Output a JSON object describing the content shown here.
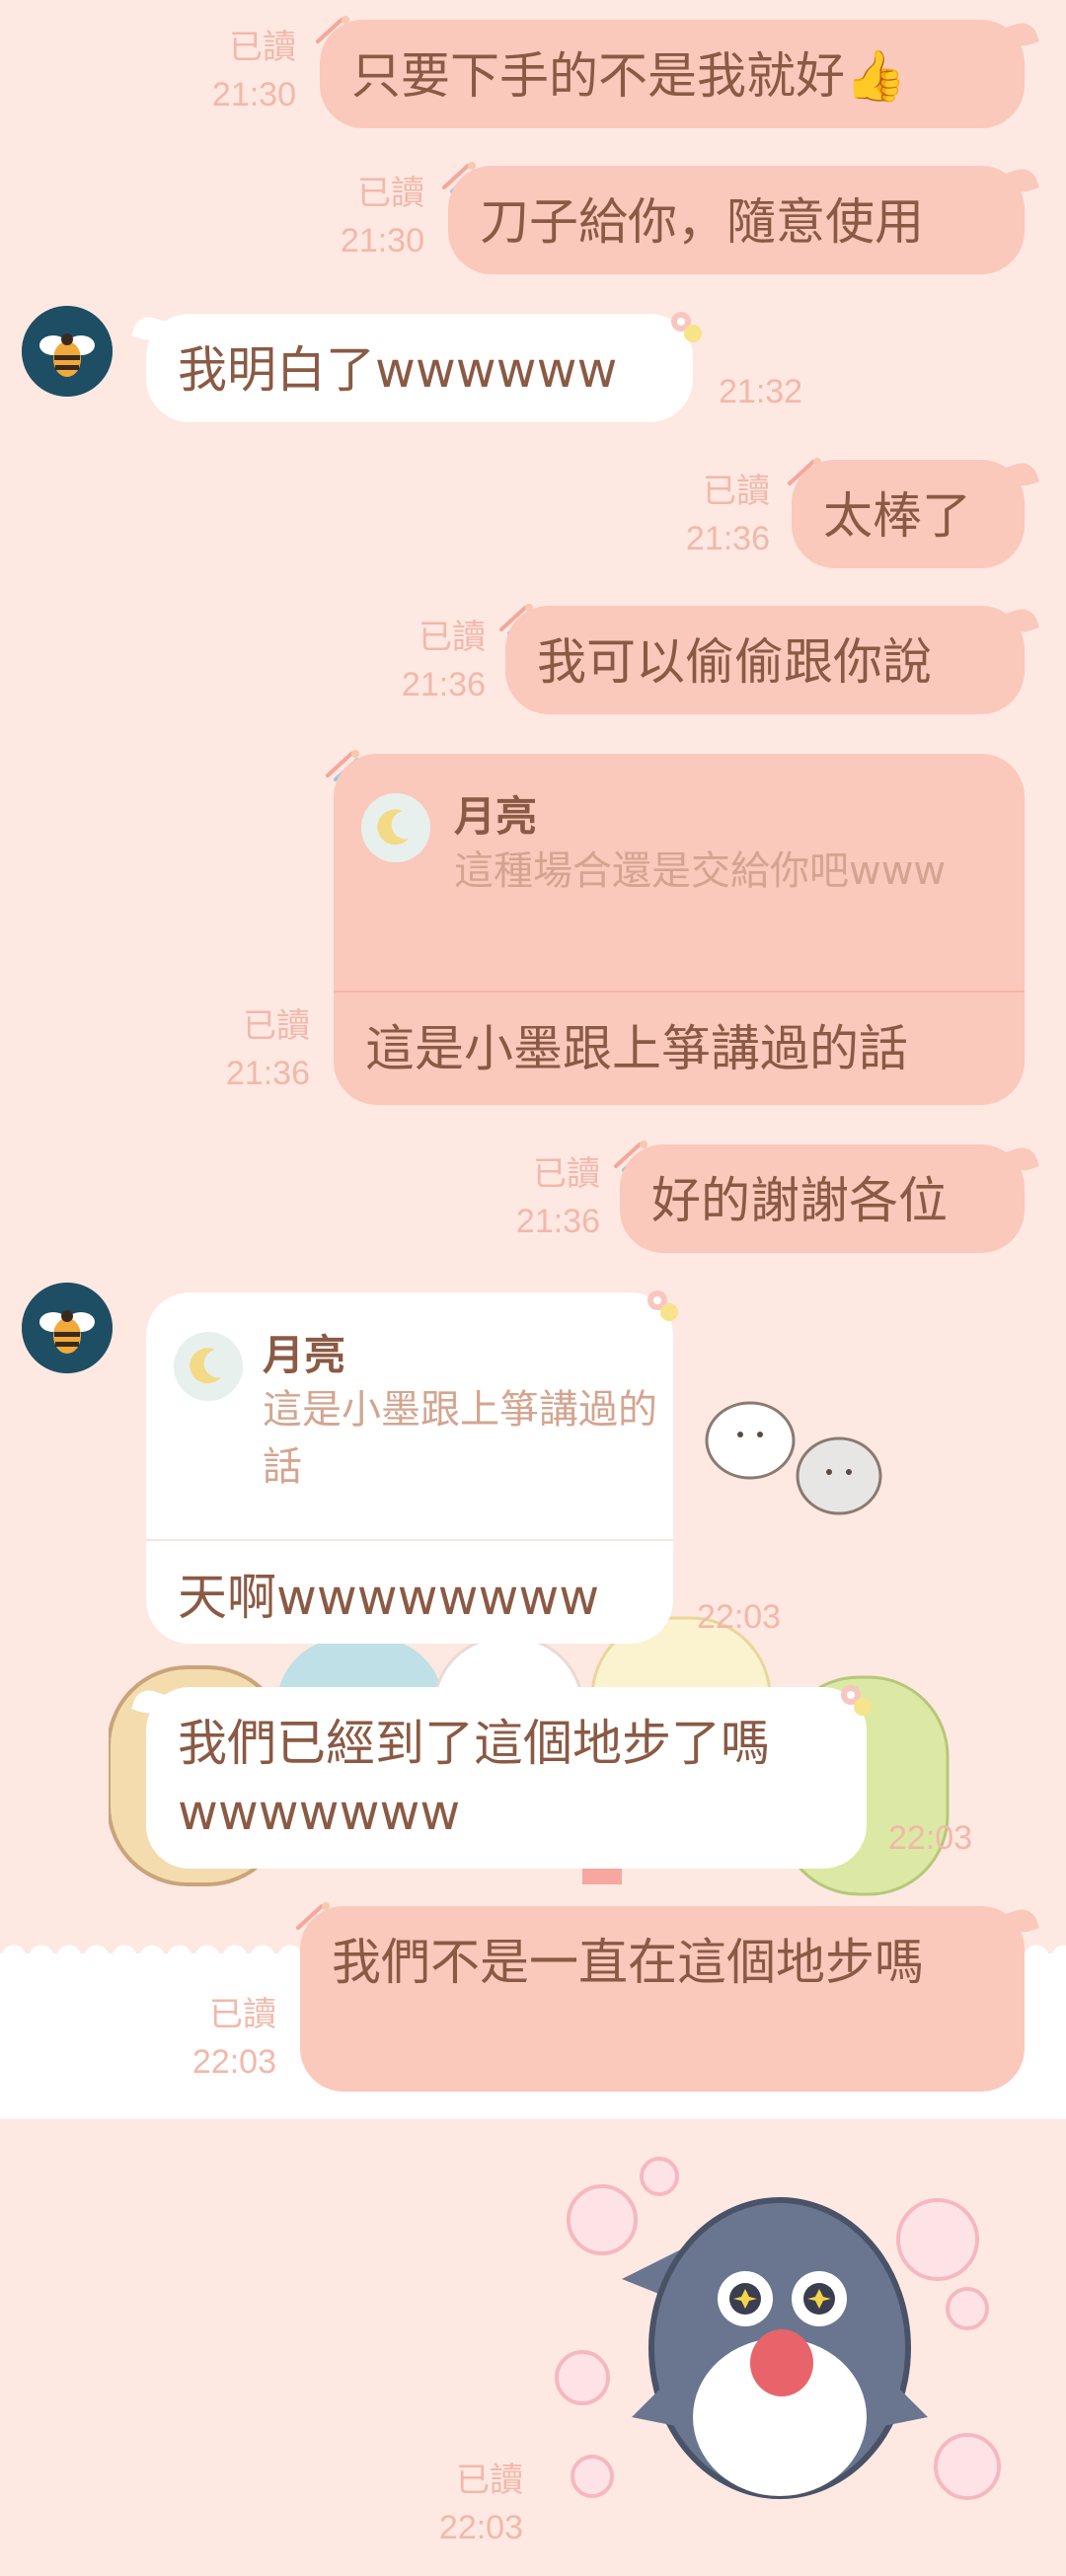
{
  "messages": [
    {
      "type": "out",
      "text": "只要下手的不是我就好👍",
      "read": "已讀",
      "time": "21:30"
    },
    {
      "type": "out",
      "text": "刀子給你，隨意使用",
      "read": "已讀",
      "time": "21:30"
    },
    {
      "type": "in",
      "text": "我明白了wwwwww",
      "time": "21:32"
    },
    {
      "type": "out",
      "text": "太棒了",
      "read": "已讀",
      "time": "21:36"
    },
    {
      "type": "out",
      "text": "我可以偷偷跟你說",
      "read": "已讀",
      "time": "21:36"
    },
    {
      "type": "out-reply",
      "quote_name": "月亮",
      "quote_text": "這種場合還是交給你吧www",
      "text": "這是小墨跟上箏講過的話",
      "read": "已讀",
      "time": "21:36"
    },
    {
      "type": "out",
      "text": "好的謝謝各位",
      "read": "已讀",
      "time": "21:36"
    },
    {
      "type": "in-reply",
      "quote_name": "月亮",
      "quote_text": "這是小墨跟上箏講過的話",
      "text": "天啊wwwwwwww",
      "time": "22:03"
    },
    {
      "type": "in",
      "text": "我們已經到了這個地步了嗎wwwwwww",
      "time": "22:03"
    },
    {
      "type": "out",
      "text": "我們不是一直在這個地步嗎",
      "read": "已讀",
      "time": "22:03"
    },
    {
      "type": "sticker",
      "sticker": "shark-sticker",
      "read": "已讀",
      "time": "22:03"
    }
  ],
  "colors": {
    "background": "#fde8e2",
    "bubble_out": "#fbc8bc",
    "bubble_in": "#ffffff",
    "text": "#8a5a44",
    "meta": "#f2b8aa"
  }
}
